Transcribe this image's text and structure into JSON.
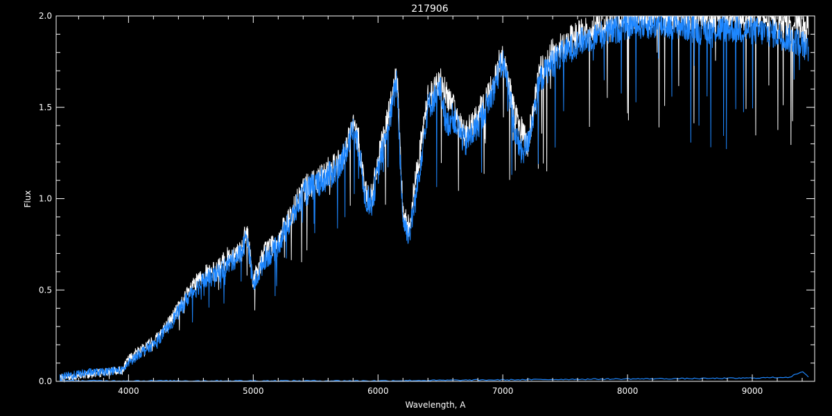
{
  "chart_data": {
    "type": "line",
    "title": "217906",
    "xlabel": "Wavelength, A",
    "ylabel": "Flux",
    "xlim": [
      3420,
      9500
    ],
    "ylim": [
      0,
      2.0
    ],
    "xticks": [
      4000,
      5000,
      6000,
      7000,
      8000,
      9000
    ],
    "xtick_labels": [
      "4000",
      "5000",
      "6000",
      "7000",
      "8000",
      "9000"
    ],
    "yticks": [
      0.0,
      0.5,
      1.0,
      1.5,
      2.0
    ],
    "ytick_labels": [
      "0.0",
      "0.5",
      "1.0",
      "1.5",
      "2.0"
    ],
    "grid": false,
    "background": "#000000",
    "axis_color": "#ffffff",
    "series": [
      {
        "color": "#ffffff",
        "x": [
          3450,
          3600,
          3800,
          3950,
          4000,
          4100,
          4200,
          4300,
          4400,
          4500,
          4600,
          4700,
          4800,
          4900,
          4950,
          5000,
          5100,
          5200,
          5300,
          5400,
          5500,
          5600,
          5700,
          5800,
          5850,
          5900,
          5950,
          6000,
          6100,
          6150,
          6200,
          6250,
          6300,
          6400,
          6500,
          6600,
          6700,
          6800,
          6900,
          7000,
          7100,
          7200,
          7300,
          7400,
          7500,
          7600,
          7800,
          8000,
          8500,
          9000,
          9450
        ],
        "y": [
          0.02,
          0.03,
          0.05,
          0.06,
          0.12,
          0.18,
          0.22,
          0.3,
          0.4,
          0.5,
          0.58,
          0.6,
          0.68,
          0.72,
          0.82,
          0.55,
          0.72,
          0.78,
          0.9,
          1.05,
          1.1,
          1.15,
          1.2,
          1.4,
          1.3,
          1.02,
          1.0,
          1.2,
          1.5,
          1.7,
          0.9,
          0.85,
          1.1,
          1.55,
          1.65,
          1.5,
          1.35,
          1.45,
          1.6,
          1.8,
          1.45,
          1.3,
          1.7,
          1.8,
          1.85,
          1.9,
          1.95,
          2.0,
          2.0,
          2.0,
          1.95
        ]
      },
      {
        "color": "#1e87ff",
        "x": [
          3450,
          3500,
          3600,
          3700,
          3800,
          3900,
          3950,
          4000,
          4100,
          4200,
          4300,
          4400,
          4500,
          4600,
          4700,
          4800,
          4900,
          4950,
          5000,
          5100,
          5150,
          5200,
          5300,
          5400,
          5500,
          5600,
          5700,
          5800,
          5850,
          5900,
          5950,
          6000,
          6100,
          6150,
          6200,
          6250,
          6300,
          6350,
          6400,
          6500,
          6550,
          6600,
          6700,
          6800,
          6900,
          7000,
          7050,
          7100,
          7150,
          7200,
          7300,
          7400,
          7500,
          7600,
          7700,
          7800,
          7900,
          8000,
          8200,
          8400,
          8600,
          8800,
          9000,
          9200,
          9400,
          9450
        ],
        "y": [
          0.02,
          0.03,
          0.04,
          0.05,
          0.05,
          0.06,
          0.06,
          0.1,
          0.16,
          0.2,
          0.28,
          0.38,
          0.48,
          0.55,
          0.58,
          0.64,
          0.7,
          0.8,
          0.52,
          0.68,
          0.7,
          0.75,
          0.88,
          1.02,
          1.08,
          1.12,
          1.18,
          1.38,
          1.25,
          1.0,
          0.98,
          1.15,
          1.45,
          1.65,
          0.88,
          0.8,
          1.0,
          1.25,
          1.5,
          1.6,
          1.4,
          1.45,
          1.3,
          1.4,
          1.55,
          1.75,
          1.6,
          1.35,
          1.25,
          1.3,
          1.65,
          1.75,
          1.8,
          1.85,
          1.88,
          1.9,
          1.92,
          1.95,
          1.95,
          1.95,
          1.92,
          1.93,
          1.92,
          1.9,
          1.85,
          1.8
        ]
      },
      {
        "color": "#1e87ff",
        "x": [
          3450,
          4000,
          5000,
          6000,
          7000,
          7500,
          8000,
          8500,
          9000,
          9300,
          9400,
          9450
        ],
        "y": [
          0.0,
          0.0,
          0.0,
          0.0,
          0.005,
          0.008,
          0.01,
          0.012,
          0.015,
          0.02,
          0.05,
          0.02
        ]
      }
    ]
  }
}
